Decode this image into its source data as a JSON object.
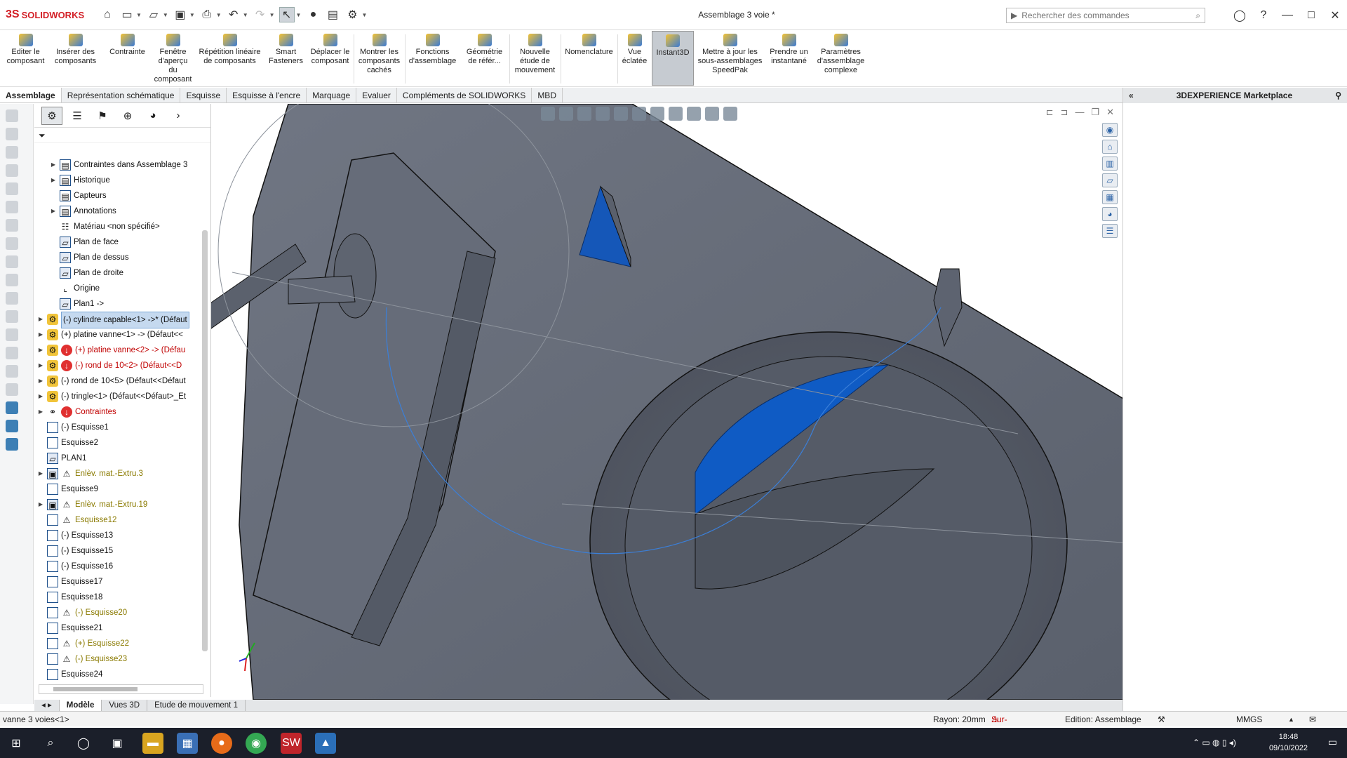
{
  "app": {
    "brand_ds": "3S",
    "brand_name": "SOLIDWORKS",
    "window_title": "Assemblage 3 voie *"
  },
  "search": {
    "placeholder": "Rechercher des commandes"
  },
  "ribbon": {
    "buttons": [
      "Editer le composant",
      "Insérer des composants",
      "Contrainte",
      "Fenêtre d'aperçu du composant",
      "Répétition linéaire de composants",
      "Smart Fasteners",
      "Déplacer le composant",
      "Montrer les composants cachés",
      "Fonctions d'assemblage",
      "Géométrie de référ...",
      "Nouvelle étude de mouvement",
      "Nomenclature",
      "Vue éclatée",
      "Instant3D",
      "Mettre à jour les sous-assemblages SpeedPak",
      "Prendre un instantané",
      "Paramètres d'assemblage complexe"
    ],
    "active_index": 13
  },
  "tabs": [
    "Assemblage",
    "Représentation schématique",
    "Esquisse",
    "Esquisse à l'encre",
    "Marquage",
    "Evaluer",
    "Compléments de SOLIDWORKS",
    "MBD"
  ],
  "tree": {
    "items": [
      {
        "label": "Contraintes dans Assemblage 3",
        "kind": "folder",
        "level": 1,
        "exp": true
      },
      {
        "label": "Historique",
        "kind": "folder",
        "level": 1,
        "exp": true
      },
      {
        "label": "Capteurs",
        "kind": "folder",
        "level": 1
      },
      {
        "label": "Annotations",
        "kind": "folder",
        "level": 1,
        "exp": true
      },
      {
        "label": "Matériau <non spécifié>",
        "kind": "mat",
        "level": 1
      },
      {
        "label": "Plan de face",
        "kind": "plane",
        "level": 1
      },
      {
        "label": "Plan de dessus",
        "kind": "plane",
        "level": 1
      },
      {
        "label": "Plan de droite",
        "kind": "plane",
        "level": 1
      },
      {
        "label": "Origine",
        "kind": "origin",
        "level": 1
      },
      {
        "label": "Plan1 ->",
        "kind": "plane",
        "level": 1
      },
      {
        "label": "(-) cylindre capable<1> ->* (Défaut",
        "kind": "part",
        "level": 0,
        "exp": true,
        "sel": true
      },
      {
        "label": "(+) platine vanne<1> -> (Défaut<<",
        "kind": "part",
        "level": 0,
        "exp": true
      },
      {
        "label": "(+) platine vanne<2> -> (Défau",
        "kind": "part-err",
        "level": 0,
        "exp": true,
        "red": true
      },
      {
        "label": "(-) rond de 10<2> (Défaut<<D",
        "kind": "part-err",
        "level": 0,
        "exp": true,
        "red": true
      },
      {
        "label": "(-) rond de 10<5> (Défaut<<Défaut",
        "kind": "part",
        "level": 0,
        "exp": true
      },
      {
        "label": "(-) tringle<1> (Défaut<<Défaut>_Et",
        "kind": "part",
        "level": 0,
        "exp": true
      },
      {
        "label": "Contraintes",
        "kind": "mates-err",
        "level": 0,
        "exp": true,
        "red": true
      },
      {
        "label": "(-) Esquisse1",
        "kind": "sketch",
        "level": 0
      },
      {
        "label": "Esquisse2",
        "kind": "sketch",
        "level": 0
      },
      {
        "label": "PLAN1",
        "kind": "plane",
        "level": 0
      },
      {
        "label": "Enlèv. mat.-Extru.3",
        "kind": "cut-warn",
        "level": 0,
        "exp": true,
        "warn": true
      },
      {
        "label": "Esquisse9",
        "kind": "sketch",
        "level": 0
      },
      {
        "label": "Enlèv. mat.-Extru.19",
        "kind": "cut-warn",
        "level": 0,
        "exp": true,
        "warn": true
      },
      {
        "label": "Esquisse12",
        "kind": "sketch-warn",
        "level": 0,
        "warn": true
      },
      {
        "label": "(-) Esquisse13",
        "kind": "sketch",
        "level": 0
      },
      {
        "label": "(-) Esquisse15",
        "kind": "sketch",
        "level": 0
      },
      {
        "label": "(-) Esquisse16",
        "kind": "sketch",
        "level": 0
      },
      {
        "label": "Esquisse17",
        "kind": "sketch",
        "level": 0
      },
      {
        "label": "Esquisse18",
        "kind": "sketch",
        "level": 0
      },
      {
        "label": "(-) Esquisse20",
        "kind": "sketch-warn",
        "level": 0,
        "warn": true
      },
      {
        "label": "Esquisse21",
        "kind": "sketch",
        "level": 0
      },
      {
        "label": "(+) Esquisse22",
        "kind": "sketch-warn",
        "level": 0,
        "warn": true
      },
      {
        "label": "(-) Esquisse23",
        "kind": "sketch-warn",
        "level": 0,
        "warn": true
      },
      {
        "label": "Esquisse24",
        "kind": "sketch",
        "level": 0
      }
    ]
  },
  "bottom_tabs": [
    "Modèle",
    "Vues 3D",
    "Etude de mouvement 1"
  ],
  "status": {
    "left": "vanne 3 voies<1>",
    "radius": "Rayon: 20mm",
    "constraint": "Sur-contraint",
    "mode": "Edition: Assemblage",
    "units": "MMGS"
  },
  "taskpane": {
    "title": "3DEXPERIENCE Marketplace"
  },
  "clock": {
    "time": "18:48",
    "date": "09/10/2022"
  },
  "colors": {
    "accent": "#1f6fd0",
    "model_gray": "#5e6470",
    "error": "#c00000",
    "brand": "#d32027"
  }
}
